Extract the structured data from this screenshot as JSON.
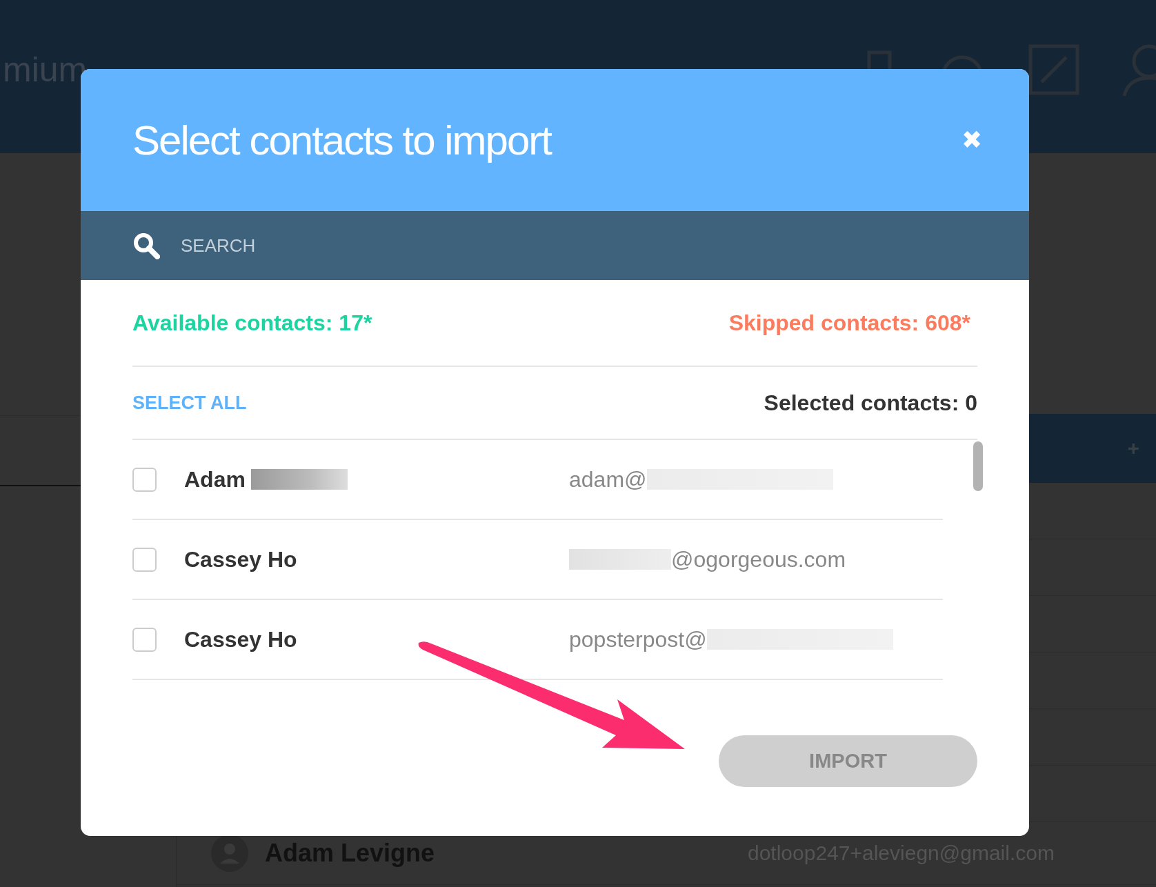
{
  "background": {
    "brand": "mium",
    "toolbar_button": "+",
    "contact": {
      "name": "Adam Levigne",
      "email": "dotloop247+aleviegn@gmail.com"
    }
  },
  "dialog": {
    "title": "Select contacts to import",
    "close": "✖",
    "search": {
      "placeholder": "SEARCH"
    },
    "available": "Available contacts: 17*",
    "skipped": "Skipped contacts: 608*",
    "select_all": "SELECT ALL",
    "selected_count": "Selected contacts: 0",
    "contacts": [
      {
        "name": "Adam",
        "name_redacted": true,
        "email": "adam@",
        "email_redacted_before": false,
        "email_redacted_after": true,
        "checked": false
      },
      {
        "name": "Cassey Ho",
        "name_redacted": false,
        "email": "@ogorgeous.com",
        "email_redacted_before": true,
        "email_redacted_after": false,
        "checked": false
      },
      {
        "name": "Cassey Ho",
        "name_redacted": false,
        "email": "popsterpost@",
        "email_redacted_before": false,
        "email_redacted_after": true,
        "checked": false
      }
    ],
    "import_button": {
      "label": "IMPORT",
      "disabled": true
    }
  }
}
